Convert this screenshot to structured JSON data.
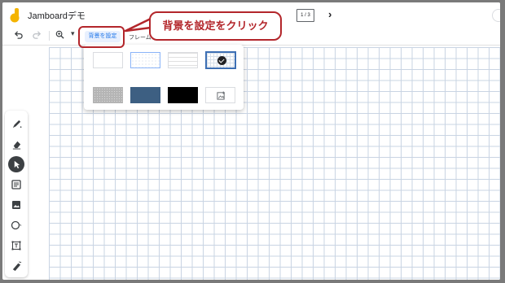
{
  "app": {
    "title": "Jamboardデモ"
  },
  "topbar": {
    "frame_counter": "1 / 3",
    "next_icon": "chevron-right-icon"
  },
  "toolbar": {
    "undo_icon": "undo-icon",
    "redo_icon": "redo-icon",
    "zoom_icon": "zoom-in-icon",
    "set_background_label": "背景を設定",
    "frame_label": "フレーム"
  },
  "background_panel": {
    "options": [
      {
        "name": "blank",
        "selected": false
      },
      {
        "name": "dots",
        "selected": false
      },
      {
        "name": "lines",
        "selected": false
      },
      {
        "name": "grid",
        "selected": true
      },
      {
        "name": "gray-dots",
        "selected": false
      },
      {
        "name": "blue",
        "selected": false
      },
      {
        "name": "black",
        "selected": false
      },
      {
        "name": "image",
        "selected": false
      }
    ]
  },
  "tools": [
    "pen-icon",
    "eraser-icon",
    "select-icon",
    "sticky-note-icon",
    "image-icon",
    "circle-icon",
    "text-box-icon",
    "laser-icon"
  ],
  "annotation": {
    "callout_text": "背景を設定をクリック",
    "color": "#b3262b"
  },
  "colors": {
    "accent": "#1a73e8",
    "grid": "#c9d4e3",
    "annotation": "#b3262b"
  }
}
